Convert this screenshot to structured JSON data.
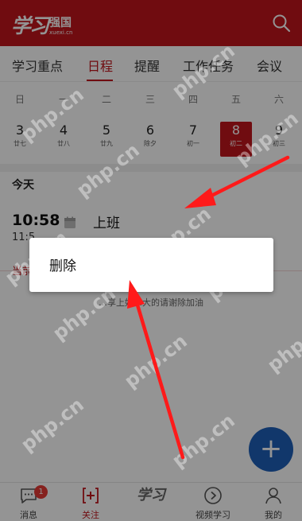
{
  "header": {
    "logo_script": "学习",
    "logo_cn": "强国",
    "logo_url": "xuexi.cn",
    "search_icon": "search-icon"
  },
  "tabs": [
    {
      "label": "学习重点"
    },
    {
      "label": "日程"
    },
    {
      "label": "提醒"
    },
    {
      "label": "工作任务"
    },
    {
      "label": "会议"
    }
  ],
  "active_tab": "日程",
  "weekdays": [
    "日",
    "一",
    "二",
    "三",
    "四",
    "五",
    "六"
  ],
  "dates": [
    {
      "day": "3",
      "lunar": "廿七"
    },
    {
      "day": "4",
      "lunar": "廿八"
    },
    {
      "day": "5",
      "lunar": "廿九"
    },
    {
      "day": "6",
      "lunar": "除夕"
    },
    {
      "day": "7",
      "lunar": "初一"
    },
    {
      "day": "8",
      "lunar": "初二"
    },
    {
      "day": "9",
      "lunar": "初三"
    }
  ],
  "selected_date": "8",
  "today_label": "今天",
  "event": {
    "time": "10:58",
    "sub_time": "11:5",
    "title": "上班",
    "current_prefix": "当前",
    "calendar_icon": "calendar-icon"
  },
  "hint_text": "…享上好…大的请谢除加油",
  "fab": {
    "label": "+"
  },
  "dialog": {
    "item": "删除"
  },
  "bottom_nav": [
    {
      "label": "消息",
      "badge": "1",
      "icon": "message-icon"
    },
    {
      "label": "关注",
      "icon": "follow-icon"
    },
    {
      "label": "",
      "icon": "xuexi-logo-icon",
      "glyph": "学习"
    },
    {
      "label": "视频学习",
      "icon": "play-circle-icon"
    },
    {
      "label": "我的",
      "icon": "user-icon"
    }
  ],
  "watermark": "php.cn",
  "colors": {
    "brand_red": "#c1161c",
    "fab_blue": "#1e5fb8",
    "arrow_red": "#ff1a1a",
    "badge_red": "#e53935"
  }
}
